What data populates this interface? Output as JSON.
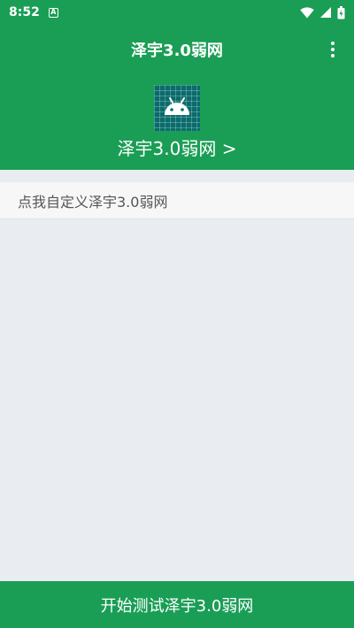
{
  "status_bar": {
    "time": "8:52",
    "notification_letter": "A",
    "icons": [
      "wifi-icon",
      "signal-icon",
      "battery-icon"
    ]
  },
  "toolbar": {
    "title": "泽宇3.0弱网",
    "menu_icon": "overflow-menu-icon"
  },
  "header": {
    "app_icon": "android-icon",
    "app_title": "泽宇3.0弱网 >"
  },
  "custom_row": {
    "label": "点我自定义泽宇3.0弱网"
  },
  "bottom_button": {
    "label": "开始测试泽宇3.0弱网"
  },
  "colors": {
    "primary": "#1a9e55",
    "background": "#e9ecf0",
    "row_background": "#f7f7f7",
    "icon_teal": "#0a6b6b"
  }
}
